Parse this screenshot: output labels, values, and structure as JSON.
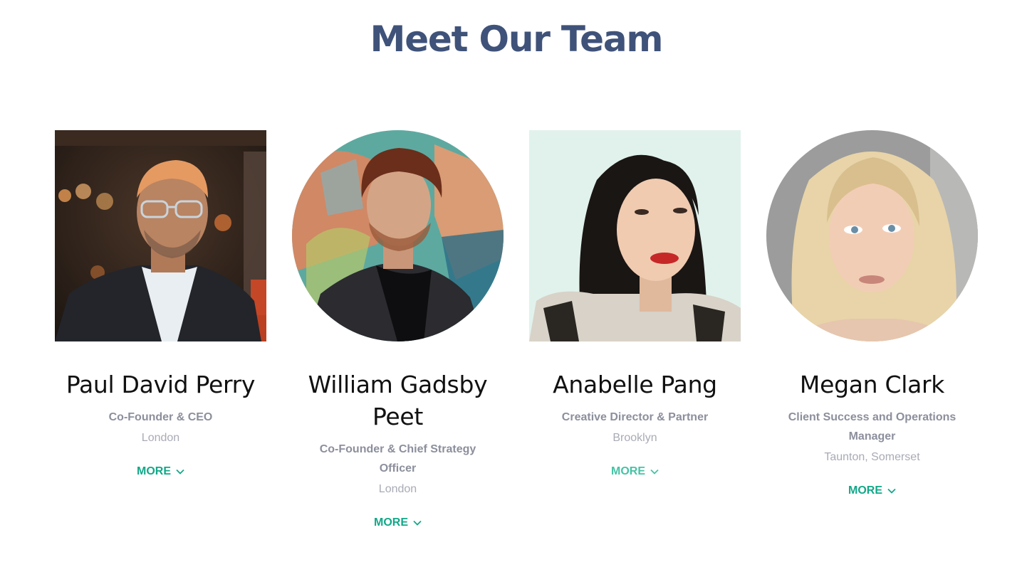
{
  "section": {
    "title": "Meet Our Team"
  },
  "team": [
    {
      "name": "Paul David Perry",
      "role": "Co-Founder & CEO",
      "location": "London",
      "more_label": "MORE",
      "more_icon": "chevron-down-icon"
    },
    {
      "name": "William Gadsby Peet",
      "role": "Co-Founder & Chief Strategy Officer",
      "location": "London",
      "more_label": "MORE",
      "more_icon": "chevron-down-icon"
    },
    {
      "name": "Anabelle Pang",
      "role": "Creative Director & Partner",
      "location": "Brooklyn",
      "more_label": "MORE",
      "more_icon": "chevron-down-icon"
    },
    {
      "name": "Megan Clark",
      "role": "Client Success and Operations Manager",
      "location": "Taunton, Somerset",
      "more_label": "MORE",
      "more_icon": "chevron-down-icon"
    }
  ],
  "colors": {
    "title": "#3f5279",
    "name": "#111111",
    "role": "#8c8f9c",
    "location": "#a9abb5",
    "link": "#12a888"
  }
}
